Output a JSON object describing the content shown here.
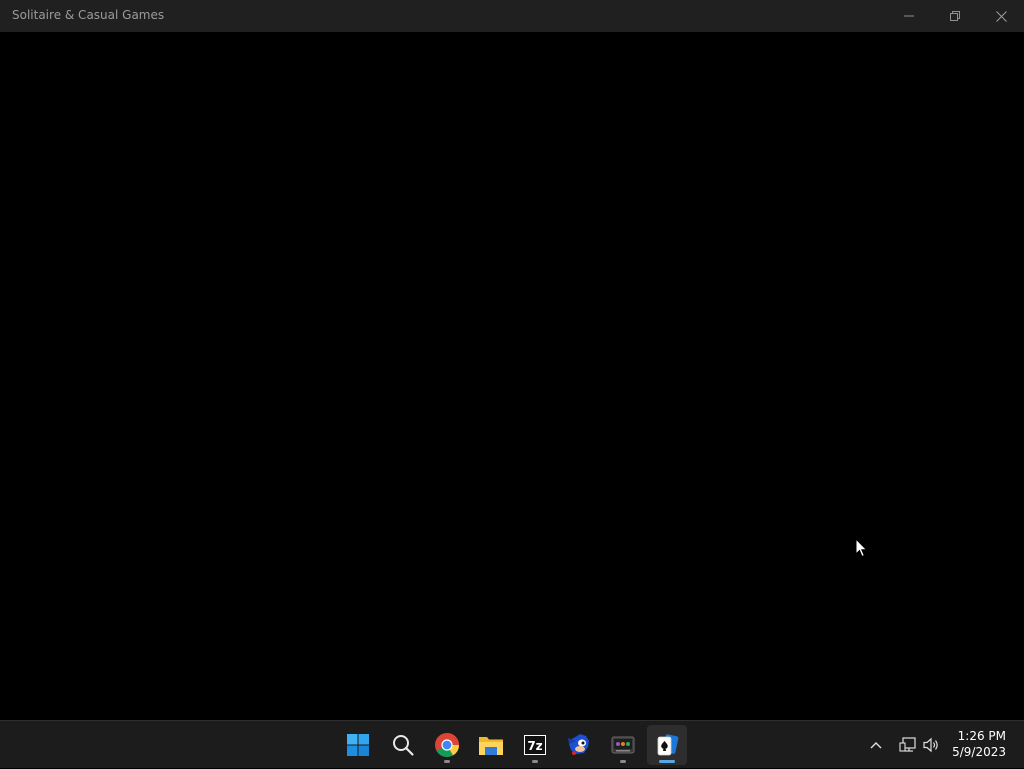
{
  "window": {
    "title": "Solitaire & Casual Games",
    "controls": [
      "minimize-icon",
      "restore-icon",
      "close-icon"
    ]
  },
  "taskbar": {
    "apps": [
      {
        "name": "start",
        "icon": "windows-start-icon",
        "running": false,
        "active": false
      },
      {
        "name": "search",
        "icon": "search-icon",
        "running": false,
        "active": false
      },
      {
        "name": "chrome",
        "icon": "chrome-icon",
        "running": true,
        "active": false
      },
      {
        "name": "file-explorer",
        "icon": "folder-icon",
        "running": false,
        "active": false
      },
      {
        "name": "7zip",
        "icon": "7zip-icon",
        "running": true,
        "active": false
      },
      {
        "name": "sonic-game",
        "icon": "sonic-icon",
        "running": false,
        "active": false
      },
      {
        "name": "media-app",
        "icon": "media-player-icon",
        "running": true,
        "active": false
      },
      {
        "name": "solitaire",
        "icon": "solitaire-icon",
        "running": true,
        "active": true
      }
    ],
    "sevenzip_label": "7z",
    "tray": {
      "icons": [
        "chevron-up-icon",
        "network-icon",
        "volume-icon"
      ],
      "time": "1:26 PM",
      "date": "5/9/2023"
    }
  },
  "colors": {
    "titlebar_bg": "#202020",
    "content_bg": "#000000",
    "taskbar_bg": "#1c1c1c",
    "accent": "#5aa7e6"
  }
}
